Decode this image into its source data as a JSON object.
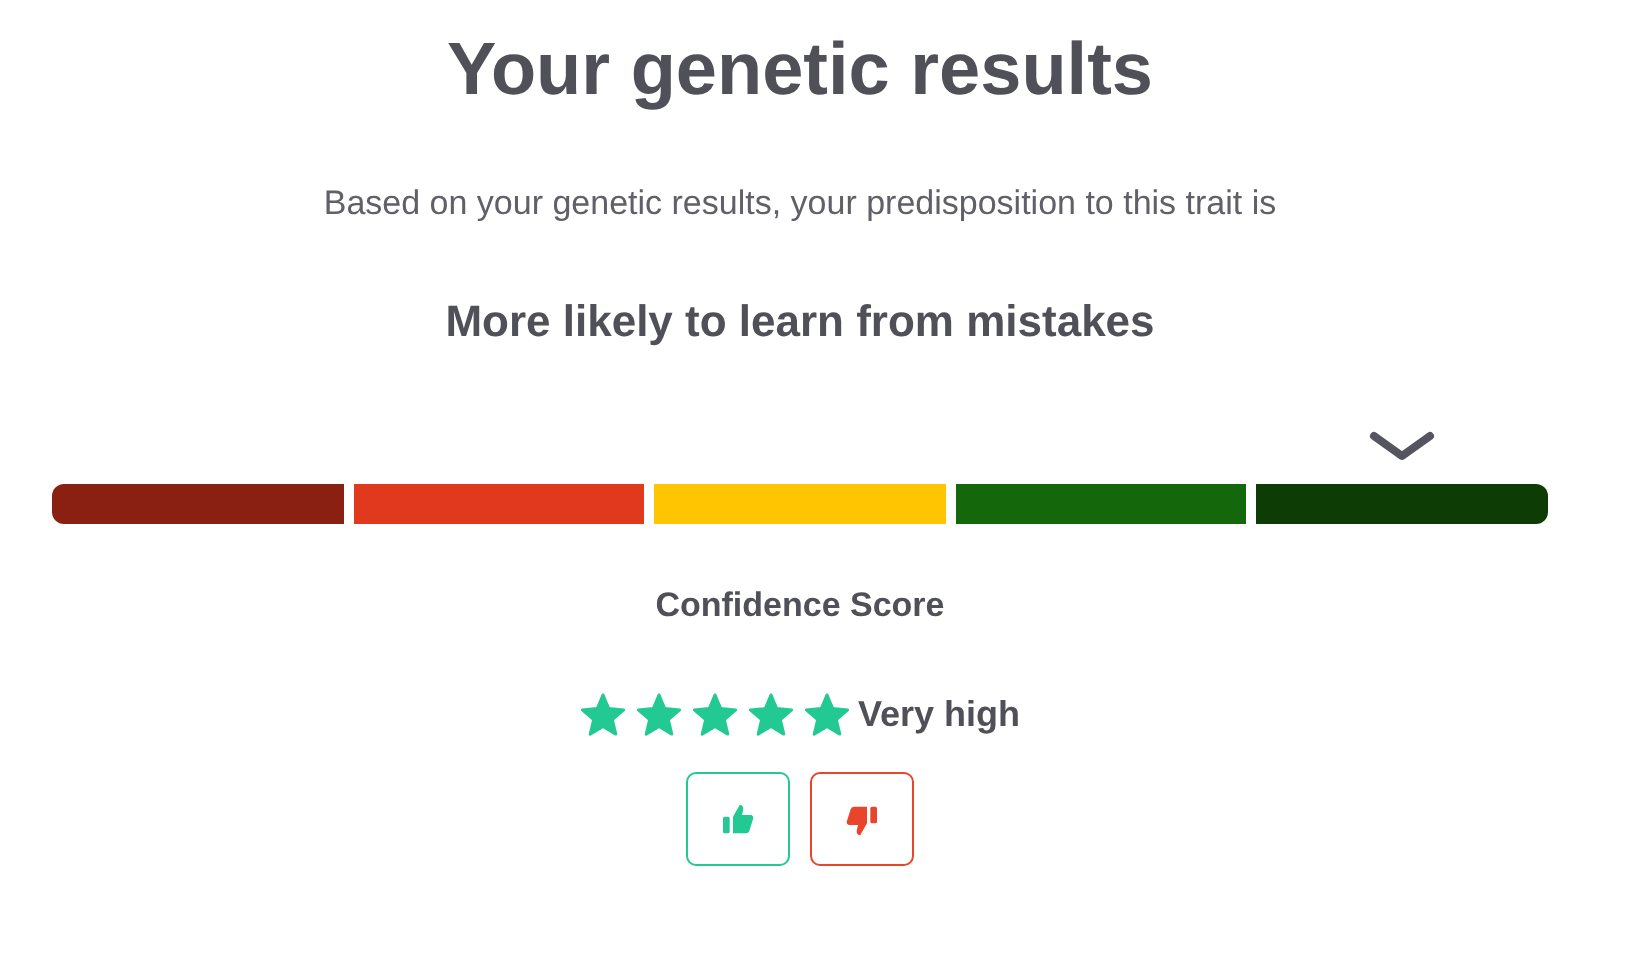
{
  "title": "Your genetic results",
  "intro": "Based on your genetic results, your predisposition to this trait is",
  "result": "More likely to learn from mistakes",
  "scale": {
    "segments": [
      {
        "color": "#8a2011",
        "selected": false
      },
      {
        "color": "#e1391d",
        "selected": false
      },
      {
        "color": "#ffc501",
        "selected": false
      },
      {
        "color": "#14680b",
        "selected": false
      },
      {
        "color": "#0d3d05",
        "selected": true
      }
    ]
  },
  "confidence": {
    "label": "Confidence Score",
    "stars": 5,
    "rating": "Very high"
  },
  "feedback": [
    {
      "kind": "up"
    },
    {
      "kind": "down"
    }
  ]
}
